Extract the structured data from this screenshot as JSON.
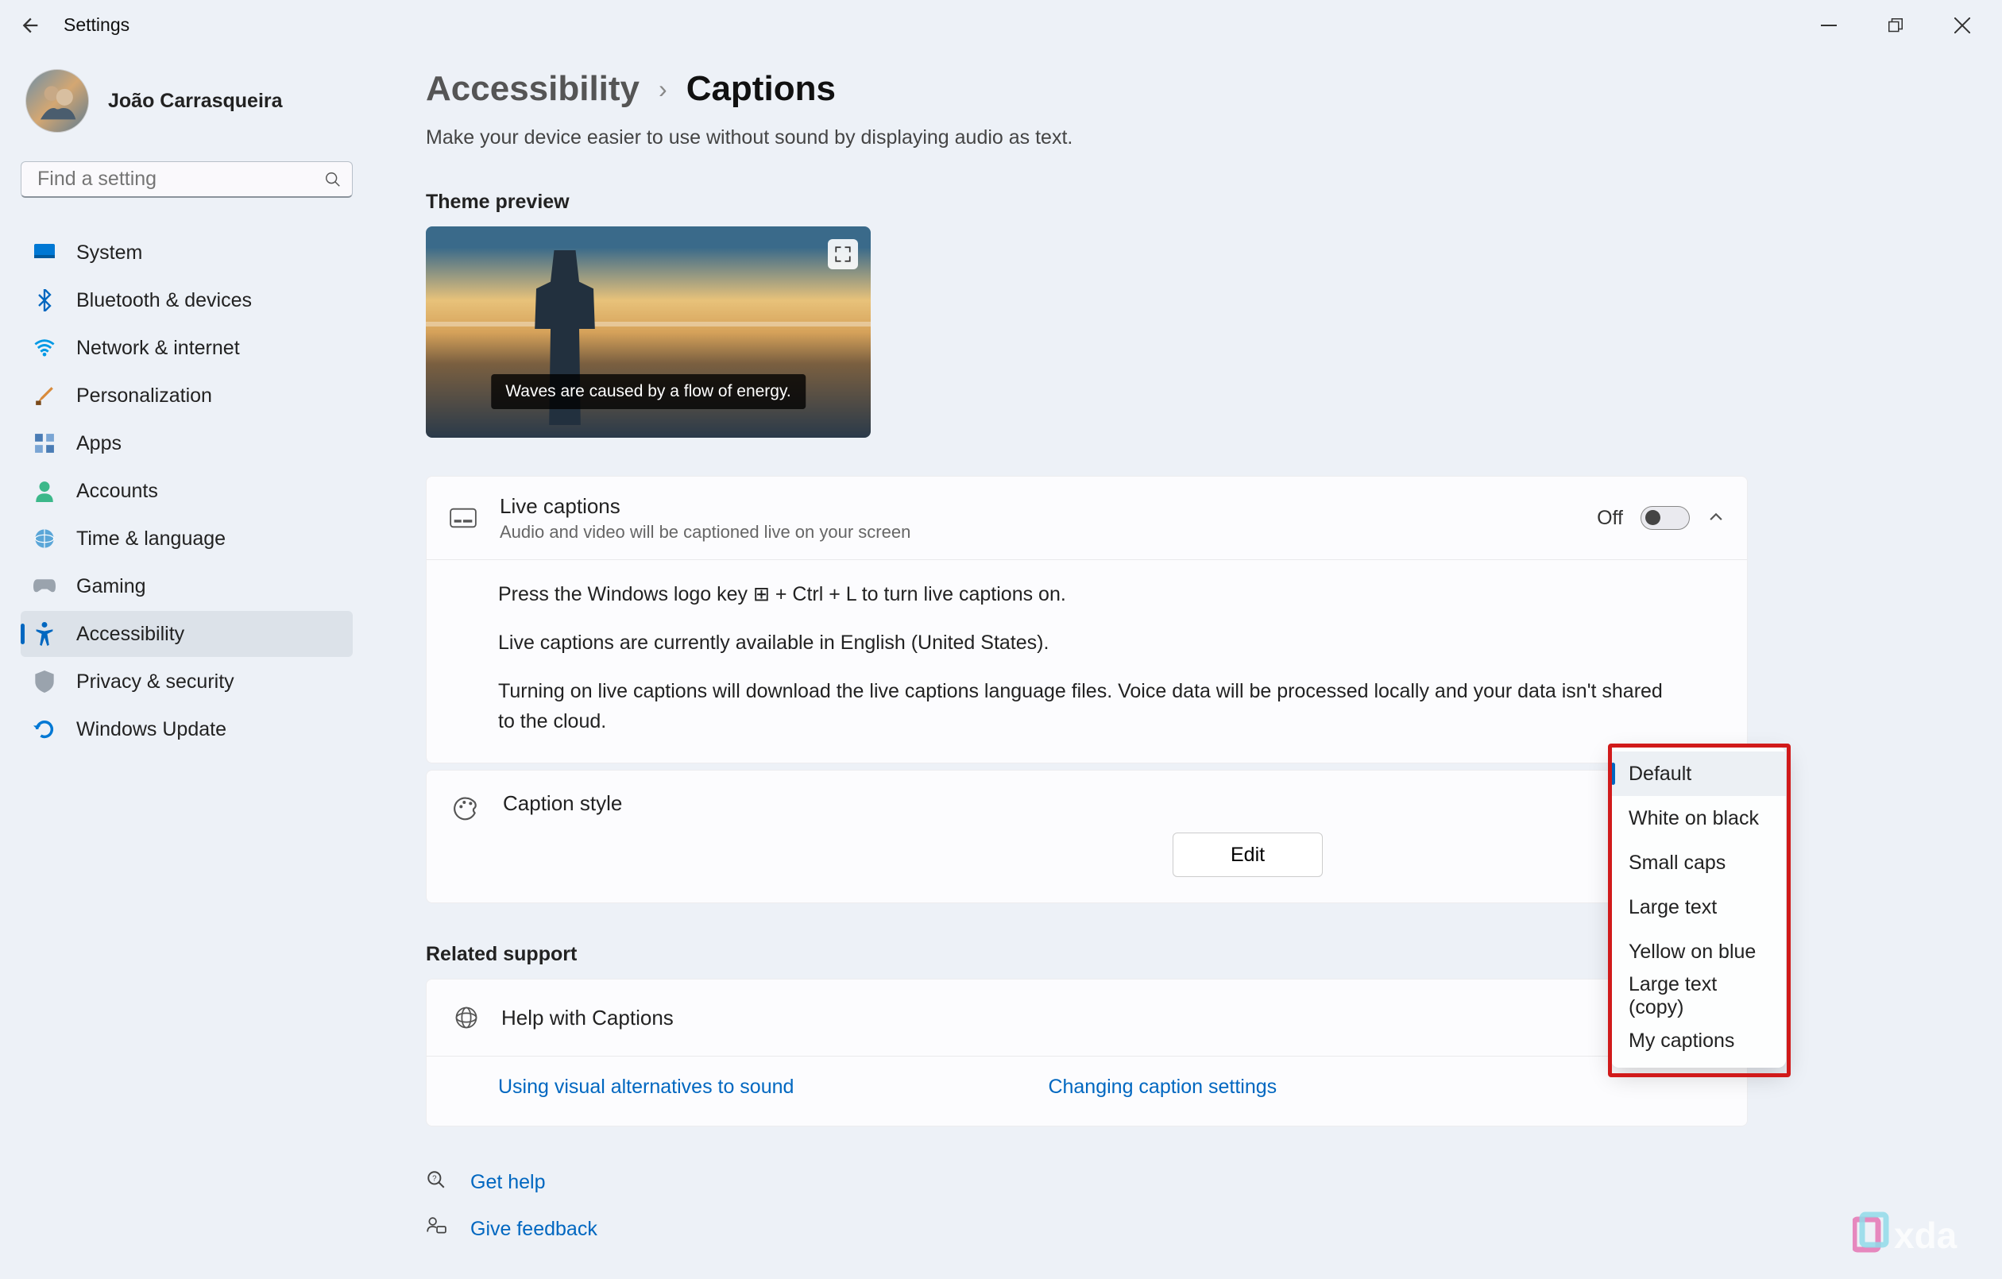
{
  "app_title": "Settings",
  "user": {
    "name": "João Carrasqueira"
  },
  "search": {
    "placeholder": "Find a setting"
  },
  "nav": {
    "items": [
      {
        "label": "System"
      },
      {
        "label": "Bluetooth & devices"
      },
      {
        "label": "Network & internet"
      },
      {
        "label": "Personalization"
      },
      {
        "label": "Apps"
      },
      {
        "label": "Accounts"
      },
      {
        "label": "Time & language"
      },
      {
        "label": "Gaming"
      },
      {
        "label": "Accessibility"
      },
      {
        "label": "Privacy & security"
      },
      {
        "label": "Windows Update"
      }
    ]
  },
  "breadcrumb": {
    "parent": "Accessibility",
    "current": "Captions"
  },
  "page_desc": "Make your device easier to use without sound by displaying audio as text.",
  "preview": {
    "section_label": "Theme preview",
    "caption_text": "Waves are caused by a flow of energy."
  },
  "live_captions": {
    "title": "Live captions",
    "subtitle": "Audio and video will be captioned live on your screen",
    "toggle_state": "Off",
    "info1": "Press the Windows logo key ⊞ + Ctrl + L to turn live captions on.",
    "info2": "Live captions are currently available in English (United States).",
    "info3": "Turning on live captions will download the live captions language files. Voice data will be processed locally and your data isn't shared to the cloud."
  },
  "caption_style": {
    "title": "Caption style",
    "edit_label": "Edit",
    "options": [
      "Default",
      "White on black",
      "Small caps",
      "Large text",
      "Yellow on blue",
      "Large text (copy)",
      "My captions"
    ]
  },
  "related": {
    "section_label": "Related support",
    "help_title": "Help with Captions",
    "links": [
      "Using visual alternatives to sound",
      "Changing caption settings"
    ]
  },
  "footer": {
    "get_help": "Get help",
    "give_feedback": "Give feedback"
  },
  "watermark": "xda"
}
